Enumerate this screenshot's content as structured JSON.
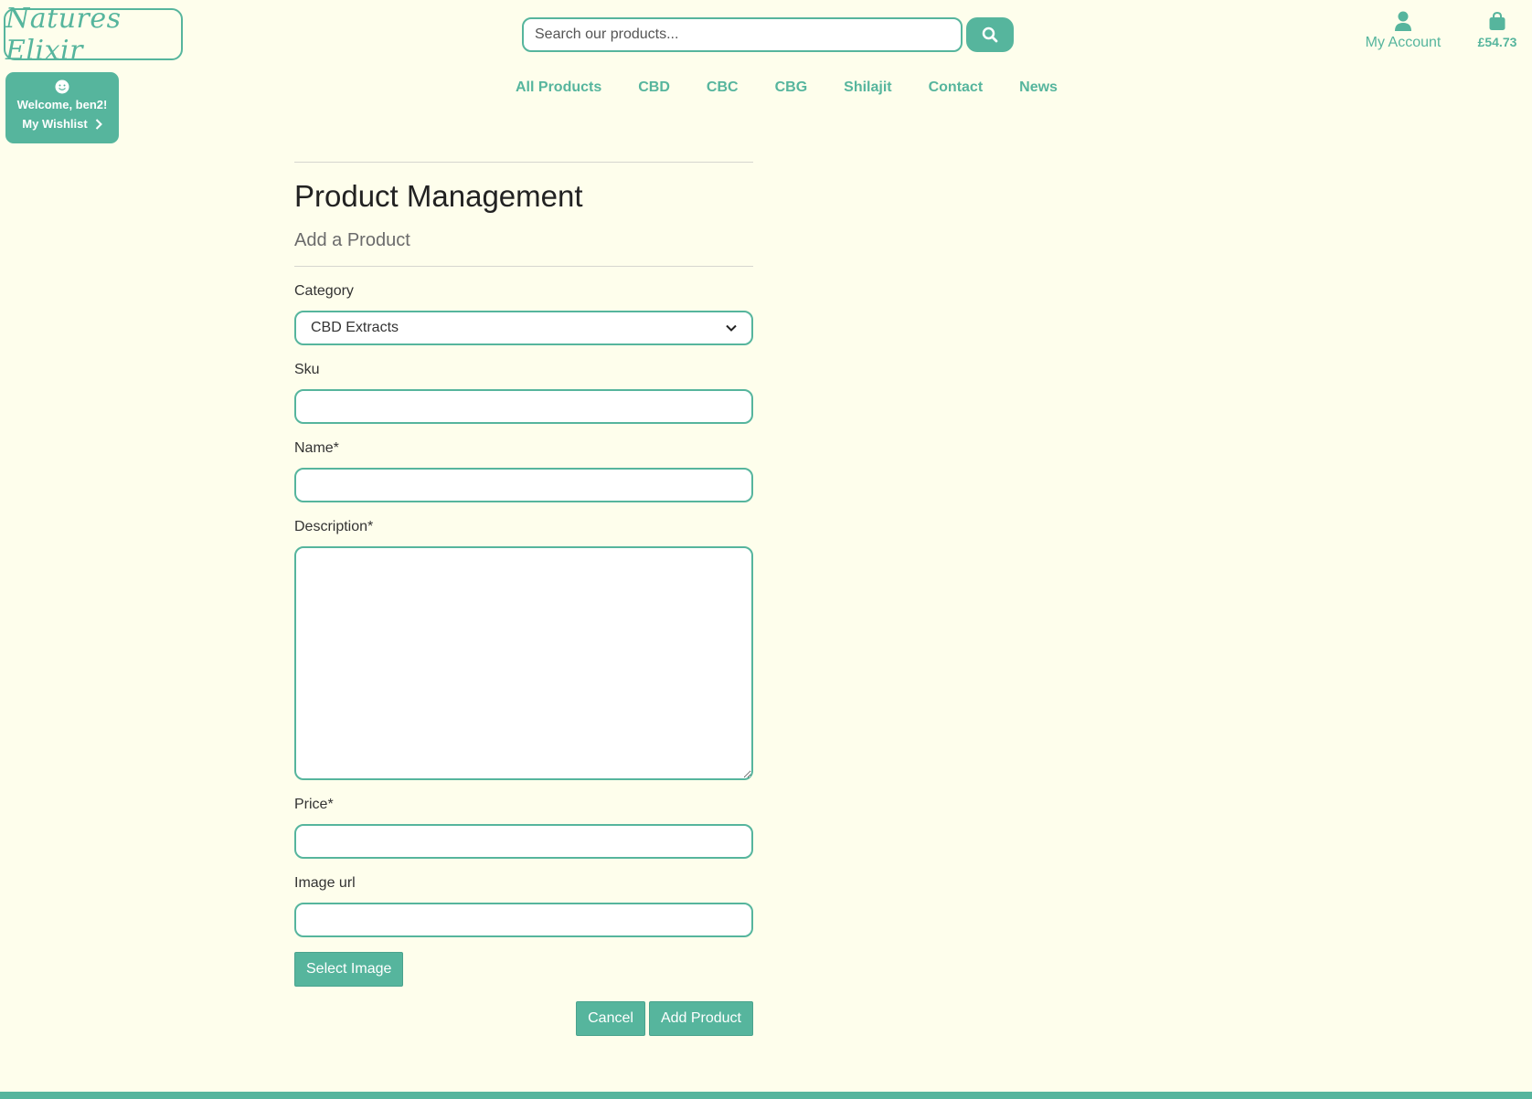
{
  "header": {
    "logo_text": "Natures Elixir",
    "search_placeholder": "Search our products...",
    "account_label": "My Account",
    "basket_total": "£54.73"
  },
  "welcome": {
    "greeting": "Welcome, ben2!",
    "wishlist_label": "My Wishlist"
  },
  "nav": {
    "items": [
      "All Products",
      "CBD",
      "CBC",
      "CBG",
      "Shilajit",
      "Contact",
      "News"
    ]
  },
  "page": {
    "title": "Product Management",
    "subtitle": "Add a Product"
  },
  "form": {
    "category_label": "Category",
    "category_value": "CBD Extracts",
    "sku_label": "Sku",
    "sku_value": "",
    "name_label": "Name*",
    "name_value": "",
    "description_label": "Description*",
    "description_value": "",
    "price_label": "Price*",
    "price_value": "",
    "image_url_label": "Image url",
    "image_url_value": "",
    "select_image_label": "Select Image",
    "cancel_label": "Cancel",
    "add_product_label": "Add Product"
  },
  "colors": {
    "accent": "#56b59d",
    "background": "#fefeec"
  }
}
